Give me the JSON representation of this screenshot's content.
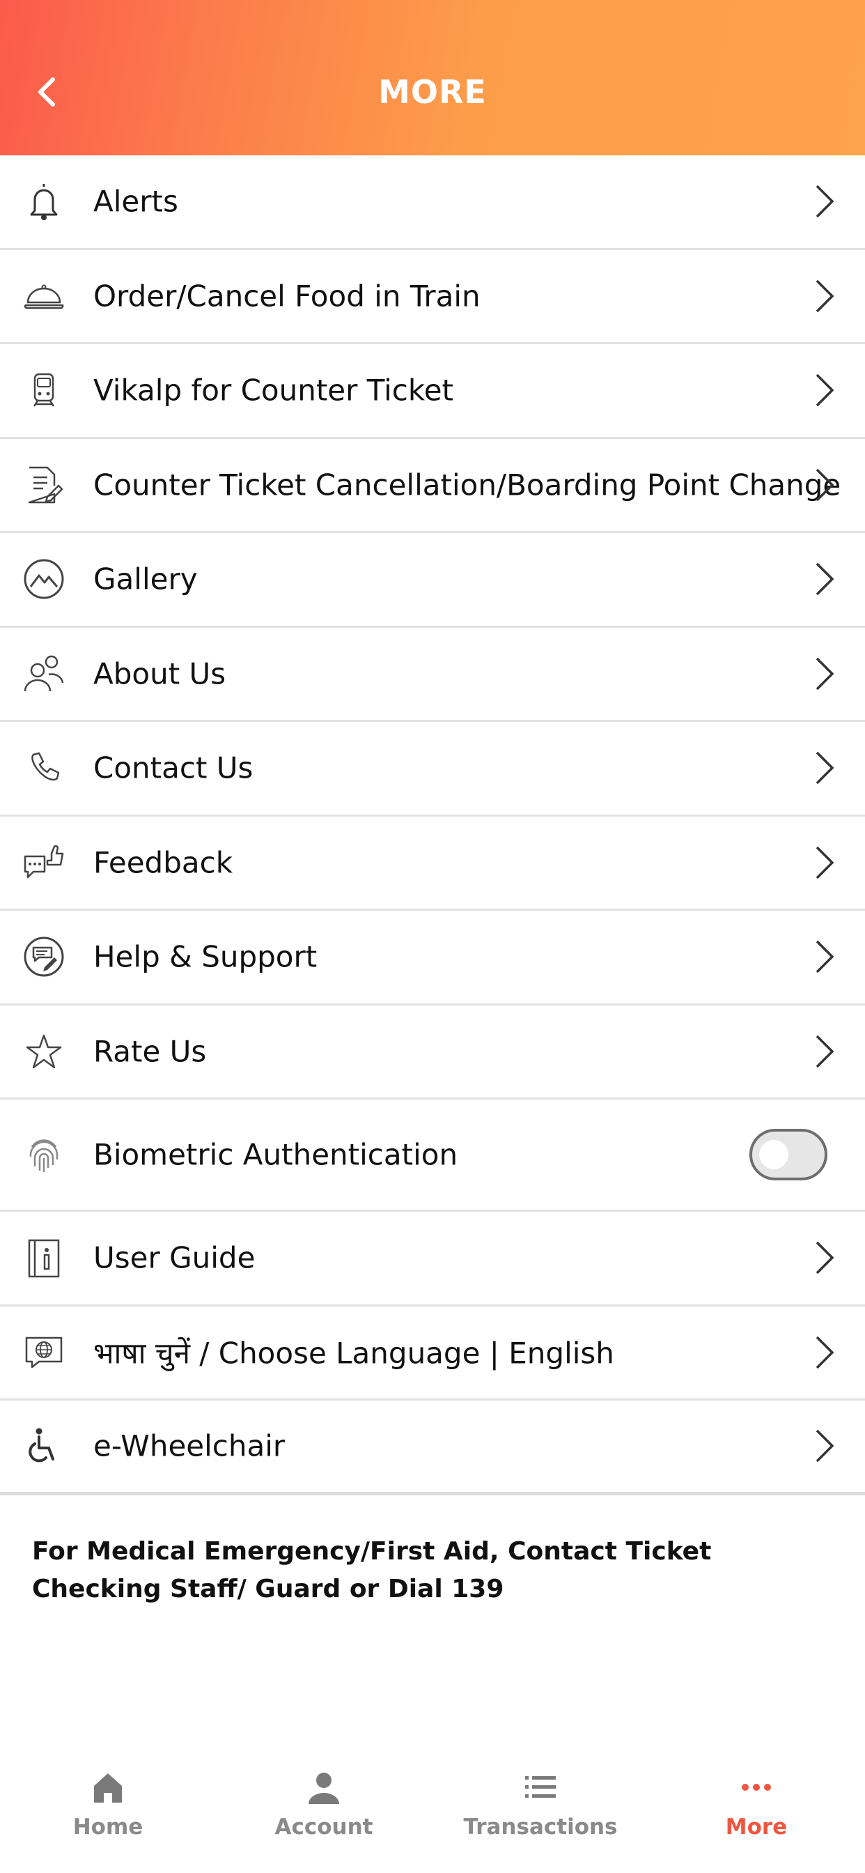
{
  "header": {
    "title": "MORE"
  },
  "menu": {
    "items": [
      {
        "label": "Alerts",
        "icon": "bell-icon"
      },
      {
        "label": "Order/Cancel Food in Train",
        "icon": "food-cloche-icon"
      },
      {
        "label": "Vikalp for Counter Ticket",
        "icon": "train-icon"
      },
      {
        "label": "Counter Ticket Cancellation/Boarding Point Change",
        "icon": "document-edit-icon"
      },
      {
        "label": "Gallery",
        "icon": "mountain-photo-icon"
      },
      {
        "label": "About Us",
        "icon": "people-icon"
      },
      {
        "label": "Contact Us",
        "icon": "phone-icon"
      },
      {
        "label": "Feedback",
        "icon": "feedback-icon"
      },
      {
        "label": "Help & Support",
        "icon": "support-icon"
      },
      {
        "label": "Rate Us",
        "icon": "star-icon"
      },
      {
        "label": "Biometric Authentication",
        "icon": "fingerprint-icon",
        "toggle": false
      },
      {
        "label": "User Guide",
        "icon": "guide-info-icon"
      },
      {
        "label": "भाषा चुनें / Choose Language | English",
        "icon": "language-globe-icon"
      },
      {
        "label": "e-Wheelchair",
        "icon": "wheelchair-icon"
      }
    ]
  },
  "notice": {
    "text": "For Medical Emergency/First Aid, Contact Ticket Checking Staff/ Guard or Dial 139"
  },
  "tabbar": {
    "tabs": [
      {
        "label": "Home",
        "icon": "home-icon"
      },
      {
        "label": "Account",
        "icon": "person-icon"
      },
      {
        "label": "Transactions",
        "icon": "list-icon"
      },
      {
        "label": "More",
        "icon": "more-dots-icon",
        "active": true
      }
    ]
  },
  "colors": {
    "accent": "#f0563f",
    "header_start": "#fb5a4c",
    "header_end": "#fda34b",
    "tab_inactive": "#8a8a8a"
  }
}
